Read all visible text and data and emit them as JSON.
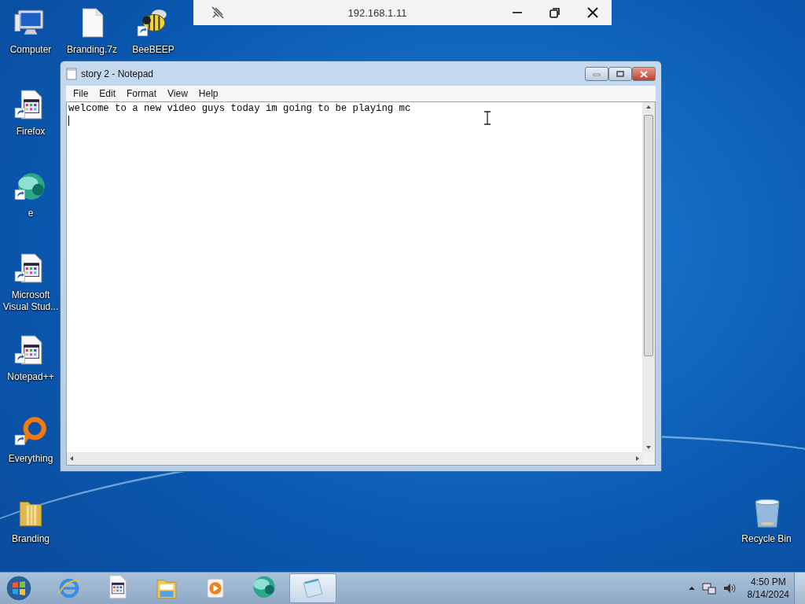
{
  "remote_bar": {
    "title": "192.168.1.11"
  },
  "desktop_icons": [
    {
      "label": "Computer",
      "kind": "computer",
      "shortcut": false
    },
    {
      "label": "Branding.7z",
      "kind": "file",
      "shortcut": false
    },
    {
      "label": "BeeBEEP",
      "kind": "bee",
      "shortcut": true
    },
    {
      "label": "Firefox",
      "kind": "app",
      "shortcut": true
    },
    {
      "label": "e",
      "kind": "sphere",
      "shortcut": true
    },
    {
      "label": "Microsoft Visual Stud...",
      "kind": "app",
      "shortcut": true
    },
    {
      "label": "Notepad++",
      "kind": "app",
      "shortcut": true
    },
    {
      "label": "Everything",
      "kind": "ring",
      "shortcut": true
    },
    {
      "label": "Branding",
      "kind": "folder",
      "shortcut": false
    },
    {
      "label": "Recycle Bin",
      "kind": "trash",
      "shortcut": false
    }
  ],
  "window": {
    "title": "story 2 - Notepad",
    "menu": [
      "File",
      "Edit",
      "Format",
      "View",
      "Help"
    ],
    "text": "welcome to a new video guys today im going to be playing mc"
  },
  "taskbar": {
    "items": [
      {
        "kind": "ie",
        "selected": false
      },
      {
        "kind": "app",
        "selected": false
      },
      {
        "kind": "explorer",
        "selected": false
      },
      {
        "kind": "media",
        "selected": false
      },
      {
        "kind": "sphere",
        "selected": false
      },
      {
        "kind": "notepad",
        "selected": true
      }
    ],
    "time": "4:50 PM",
    "date": "8/14/2024"
  }
}
